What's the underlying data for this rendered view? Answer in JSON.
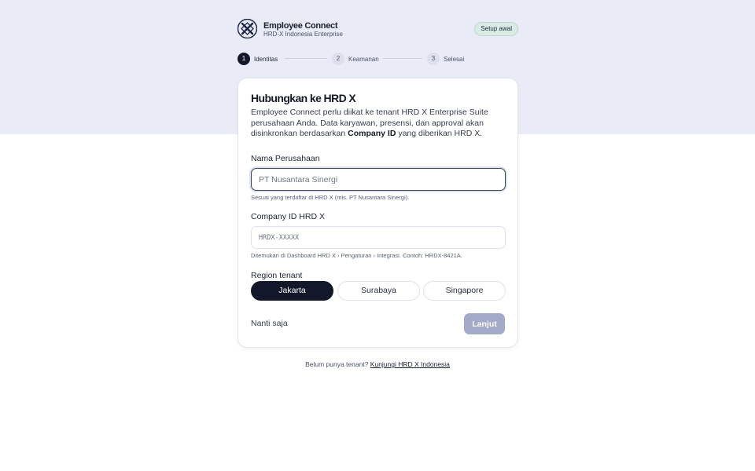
{
  "brand": {
    "name": "Employee Connect",
    "subtitle": "HRD-X Indonesia Enterprise",
    "logo_icon": "hrdx-logo-icon"
  },
  "setup_badge": "Setup awal",
  "stepper": {
    "steps": [
      {
        "number": "1",
        "label": "Identitas",
        "state": "active"
      },
      {
        "number": "2",
        "label": "Keamanan",
        "state": "idle"
      },
      {
        "number": "3",
        "label": "Selesai",
        "state": "idle"
      }
    ]
  },
  "card": {
    "title": "Hubungkan ke HRD X",
    "description_prefix": "Employee Connect perlu diikat ke tenant HRD X Enterprise Suite perusahaan Anda. Data karyawan, presensi, dan approval akan disinkronkan berdasarkan ",
    "description_bold": "Company ID",
    "description_suffix": " yang diberikan HRD X."
  },
  "form": {
    "company_name": {
      "label": "Nama Perusahaan",
      "value": "",
      "placeholder": "PT Nusantara Sinergi",
      "hint": "Sesuai yang terdaftar di HRD X (mis. PT Nusantara Sinergi)."
    },
    "company_id": {
      "label": "Company ID HRD X",
      "value": "",
      "placeholder": "HRDX-XXXXX",
      "hint": "Ditemukan di Dashboard HRD X › Pengaturan › Integrasi. Contoh: HRDX-8421A."
    },
    "region": {
      "label": "Region tenant",
      "options": [
        "Jakarta",
        "Surabaya",
        "Singapore"
      ],
      "selected": "Jakarta"
    }
  },
  "actions": {
    "later_label": "Nanti saja",
    "next_label": "Lanjut"
  },
  "footer": {
    "prefix": "Belum punya tenant?",
    "link_label": "Kunjungi HRD X Indonesia"
  },
  "colors": {
    "band_bg": "#e9ebf6",
    "primary_dark": "#12182a",
    "next_disabled": "#a3a9c8",
    "badge_bg": "#d8ebe4"
  }
}
